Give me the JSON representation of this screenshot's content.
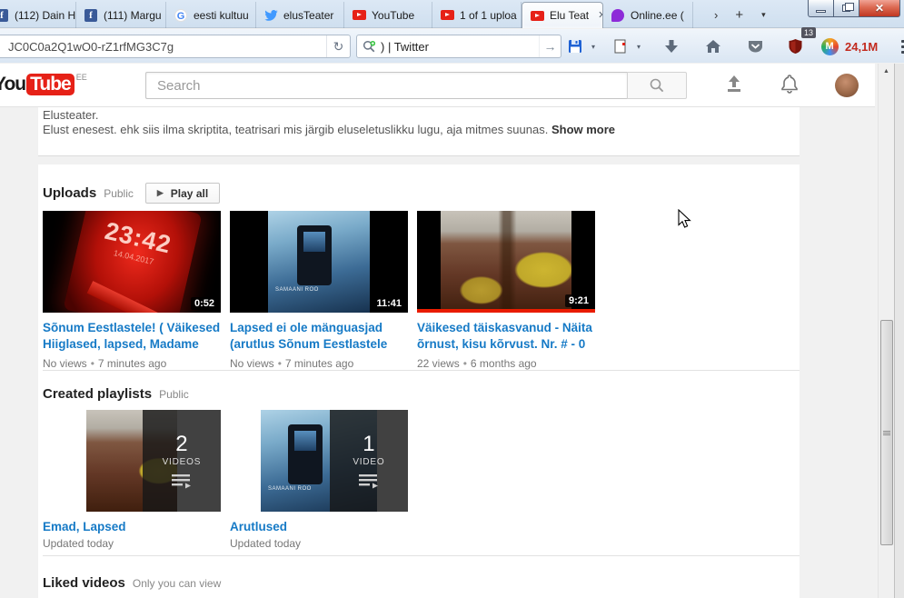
{
  "colors": {
    "accent_red": "#e62117",
    "link_blue": "#167ac6",
    "meta_gray": "#767676",
    "badge_bg": "#53545e"
  },
  "icons": {
    "reload": "↻",
    "go_arrow": "→",
    "caret_down": "▾",
    "chevron_right": "›",
    "new_tab_plus": "+",
    "close_x": "✕",
    "play_triangle": "▶",
    "bullet": "•",
    "scroll_up_arrow": "▲",
    "facebook_f": "f",
    "google_g": "G",
    "m_letter": "M"
  },
  "browser": {
    "tabs": [
      {
        "label": "(112) Dain H",
        "icon": "facebook"
      },
      {
        "label": "(111) Margu",
        "icon": "facebook"
      },
      {
        "label": "eesti kultuu",
        "icon": "google"
      },
      {
        "label": "elusTeater",
        "icon": "twitter"
      },
      {
        "label": "YouTube",
        "icon": "youtube"
      },
      {
        "label": "1 of 1 uploa",
        "icon": "youtube"
      },
      {
        "label": "Elu Teat",
        "icon": "youtube"
      },
      {
        "label": "Online.ee (",
        "icon": "online"
      }
    ],
    "urlbar": {
      "value": "JC0C0a2Q1wO0-rZ1rfMG3C7g"
    },
    "searchbar": {
      "value": ") | Twitter"
    },
    "shield_badge": "13",
    "counter": "24,1M"
  },
  "youtube": {
    "logo": {
      "you": "You",
      "tube": "Tube",
      "country": "EE"
    },
    "search_placeholder": "Search",
    "description": {
      "line1": "Elusteater.",
      "line2": "Elust enesest. ehk siis ilma skriptita, teatrisari mis järgib eluseletuslikku lugu, aja mitmes suunas.",
      "show_more": "Show more"
    },
    "uploads": {
      "title": "Uploads",
      "visibility": "Public",
      "play_all": "Play all",
      "videos": [
        {
          "title": "Sõnum Eestlastele! ( Väikesed Hiiglased, lapsed, Madame Mer...",
          "duration": "0:52",
          "views": "No views",
          "age": "7 minutes ago",
          "thumb_clock": "23:42",
          "thumb_date": "14.04.2017"
        },
        {
          "title": "Lapsed ei ole mänguasjad (arutlus Sõnum Eestlastele järel..",
          "duration": "11:41",
          "views": "No views",
          "age": "7 minutes ago",
          "thumb_label": "SAMAANI ROO"
        },
        {
          "title": "Väikesed täiskasvanud - Näita õrnust, kisu kõrvust. Nr. # - 0 +",
          "duration": "9:21",
          "views": "22 views",
          "age": "6 months ago"
        }
      ]
    },
    "playlists": {
      "title": "Created playlists",
      "visibility": "Public",
      "items": [
        {
          "title": "Emad, Lapsed",
          "updated": "Updated today",
          "count": "2",
          "count_label": "VIDEOS"
        },
        {
          "title": "Arutlused",
          "updated": "Updated today",
          "count": "1",
          "count_label": "VIDEO",
          "thumb_label": "SAMAANI ROO"
        }
      ]
    },
    "liked": {
      "title": "Liked videos",
      "visibility": "Only you can view"
    }
  }
}
